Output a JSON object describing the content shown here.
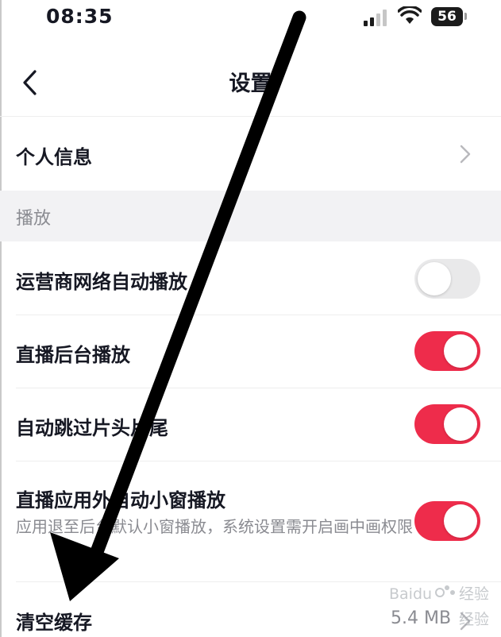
{
  "status_bar": {
    "time": "08:35",
    "battery_level": "56",
    "icons": [
      "signal-icon",
      "wifi-icon",
      "battery-icon"
    ]
  },
  "nav": {
    "title": "设置",
    "back_icon": "back-chevron-icon"
  },
  "rows": {
    "personal_info": {
      "label": "个人信息",
      "icon": "chevron-right-icon"
    },
    "section_playback": "播放",
    "carrier_autoplay": {
      "label": "运营商网络自动播放",
      "enabled": false
    },
    "live_background": {
      "label": "直播后台播放",
      "enabled": true
    },
    "skip_intro": {
      "label": "自动跳过片头片尾",
      "enabled": true
    },
    "live_pip": {
      "label": "直播应用外自动小窗播放",
      "description": "应用退至后台默认小窗播放，系统设置需开启画中画权限",
      "enabled": true
    },
    "clear_cache": {
      "label": "清空缓存",
      "size": "5.4 MB",
      "icon": "chevron-right-icon"
    }
  },
  "colors": {
    "accent": "#ee2c4b",
    "toggle_off": "#e9e9ea",
    "section_bg": "#f2f2f4",
    "secondary_text": "#8a8b91"
  },
  "watermark": {
    "brand": "Baidu",
    "text_top": "经验",
    "text_bottom": "经验"
  }
}
